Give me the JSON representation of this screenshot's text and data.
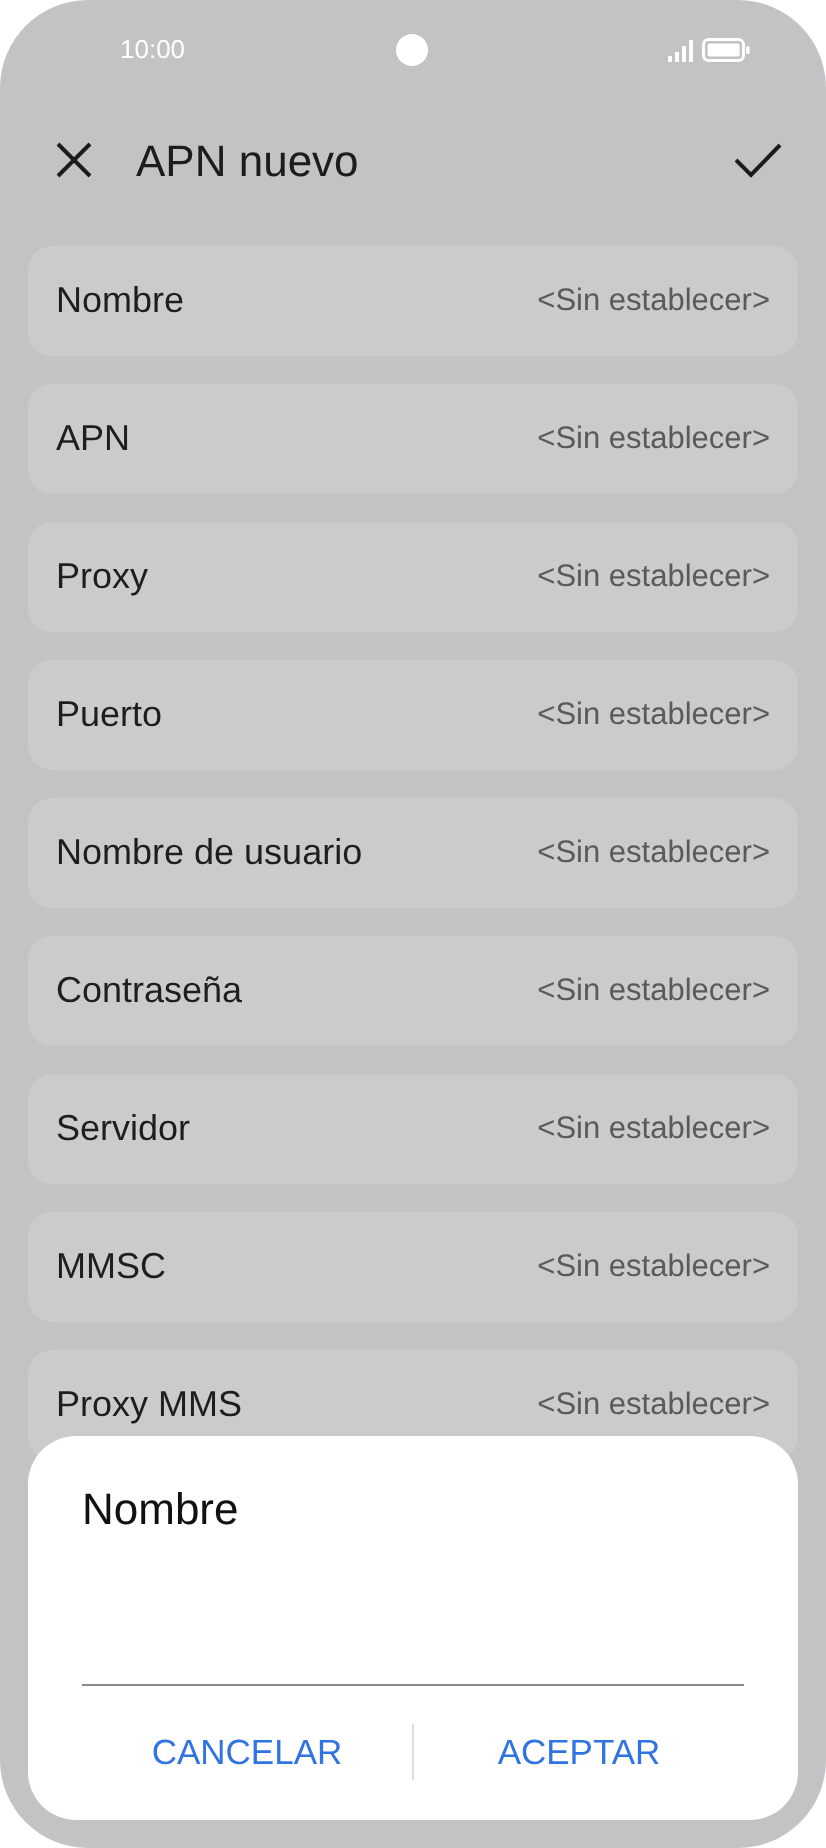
{
  "status_bar": {
    "time": "10:00"
  },
  "header": {
    "title": "APN nuevo"
  },
  "fields": [
    {
      "label": "Nombre",
      "value": "<Sin establecer>"
    },
    {
      "label": "APN",
      "value": "<Sin establecer>"
    },
    {
      "label": "Proxy",
      "value": "<Sin establecer>"
    },
    {
      "label": "Puerto",
      "value": "<Sin establecer>"
    },
    {
      "label": "Nombre de usuario",
      "value": "<Sin establecer>"
    },
    {
      "label": "Contraseña",
      "value": "<Sin establecer>"
    },
    {
      "label": "Servidor",
      "value": "<Sin establecer>"
    },
    {
      "label": "MMSC",
      "value": "<Sin establecer>"
    },
    {
      "label": "Proxy MMS",
      "value": "<Sin establecer>"
    }
  ],
  "dialog": {
    "title": "Nombre",
    "buttons": [
      "CANCELAR",
      "ACEPTAR"
    ]
  }
}
